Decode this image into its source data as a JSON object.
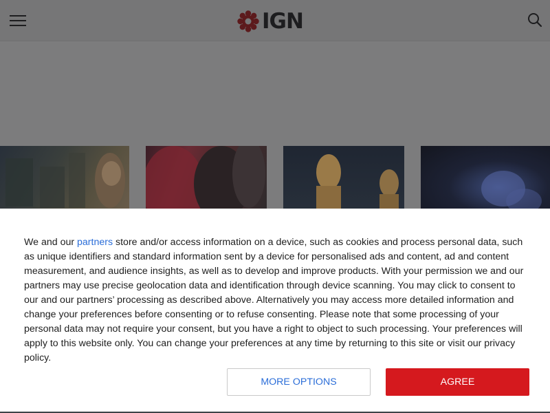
{
  "header": {
    "logo_text": "IGN",
    "menu_icon": "hamburger-menu-icon",
    "search_icon": "search-icon",
    "brand_color": "#bf1313"
  },
  "thumbnails": [
    {
      "name": "article-thumbnail-1",
      "depicts": "character-in-ruins"
    },
    {
      "name": "article-thumbnail-2",
      "depicts": "red-haired-character"
    },
    {
      "name": "article-thumbnail-3",
      "depicts": "golden-statues"
    },
    {
      "name": "article-thumbnail-4",
      "depicts": "blue-glowing-figure"
    }
  ],
  "consent": {
    "text_before_link": "We and our ",
    "link_text": "partners",
    "text_after_link": " store and/or access information on a device, such as cookies and process personal data, such as unique identifiers and standard information sent by a device for personalised ads and content, ad and content measurement, and audience insights, as well as to develop and improve products. With your permission we and our partners may use precise geolocation data and identification through device scanning. You may click to consent to our and our partners’ processing as described above. Alternatively you may access more detailed information and change your preferences before consenting or to refuse consenting. Please note that some processing of your personal data may not require your consent, but you have a right to object to such processing. Your preferences will apply to this website only. You can change your preferences at any time by returning to this site or visit our privacy policy.",
    "more_options_label": "MORE OPTIONS",
    "agree_label": "AGREE",
    "link_color": "#2a6dd8",
    "agree_color": "#d5191e"
  }
}
